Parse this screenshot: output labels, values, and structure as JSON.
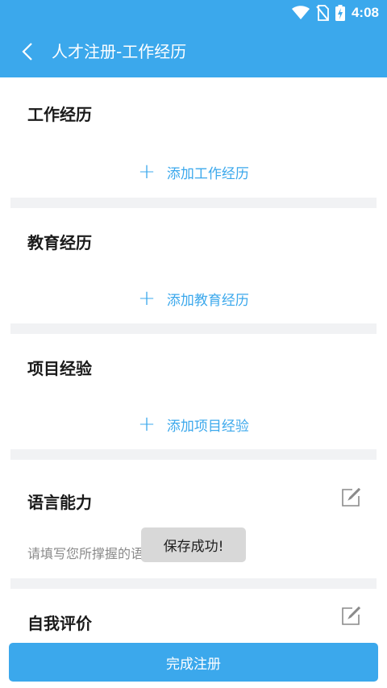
{
  "status_bar": {
    "time": "4:08"
  },
  "app_bar": {
    "title": "人才注册-工作经历"
  },
  "sections": {
    "work": {
      "title": "工作经历",
      "add_label": "添加工作经历"
    },
    "education": {
      "title": "教育经历",
      "add_label": "添加教育经历"
    },
    "project": {
      "title": "项目经验",
      "add_label": "添加项目经验"
    },
    "language": {
      "title": "语言能力",
      "hint": "请填写您所撑握的语"
    },
    "self_eval": {
      "title": "自我评价"
    }
  },
  "toast": {
    "message": "保存成功!"
  },
  "footer": {
    "finish_label": "完成注册"
  },
  "colors": {
    "primary": "#3ba8ec",
    "separator": "#f1f2f4"
  }
}
